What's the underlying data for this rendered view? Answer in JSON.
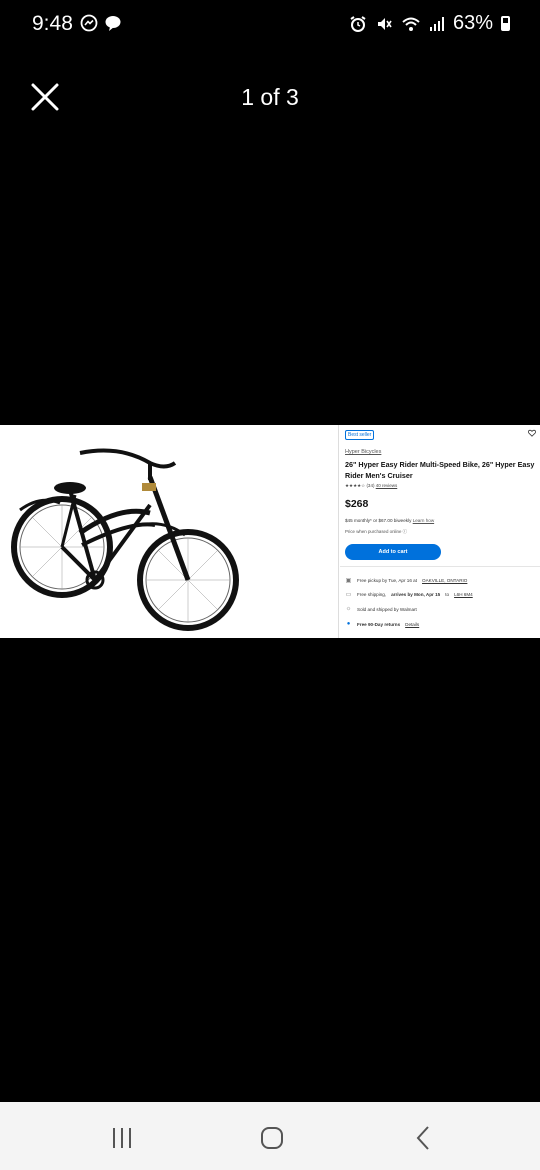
{
  "status": {
    "time": "9:48",
    "battery": "63%",
    "left_icons": [
      "messenger-icon",
      "chat-bubble-icon"
    ],
    "right_icons": [
      "alarm-icon",
      "mute-icon",
      "wifi-icon",
      "signal-icon",
      "battery-icon"
    ]
  },
  "viewer": {
    "pager": "1 of 3"
  },
  "product": {
    "badge": "Best seller",
    "brand": "Hyper Bicycles",
    "title": "26\" Hyper Easy Rider Multi-Speed Bike, 26\" Hyper Easy Rider Men's Cruiser",
    "rating_stars": "★★★★☆",
    "rating_count": "(34)",
    "reviews_link": "40 reviews",
    "price": "$268",
    "monthly_text": "$45 monthly* or $67.00 biweekly",
    "learn_how": "Learn how",
    "note": "Price when purchased online ⓘ",
    "add_to_cart": "Add to cart",
    "pickup_text": "Free pickup by Tue, Apr 16 at",
    "pickup_store": "OAKVILLE, ONTARIO",
    "shipping_text": "Free shipping,",
    "shipping_bold": "arrives by Mon, Apr 15",
    "shipping_to": "to",
    "shipping_postal": "L6H 6M4",
    "sold_by": "Sold and shipped by Walmart",
    "returns_text": "Free 90-Day returns",
    "returns_link": "Details"
  },
  "colors": {
    "accent": "#0071dc",
    "background": "#000000",
    "nav_bar": "#f4f4f4"
  }
}
